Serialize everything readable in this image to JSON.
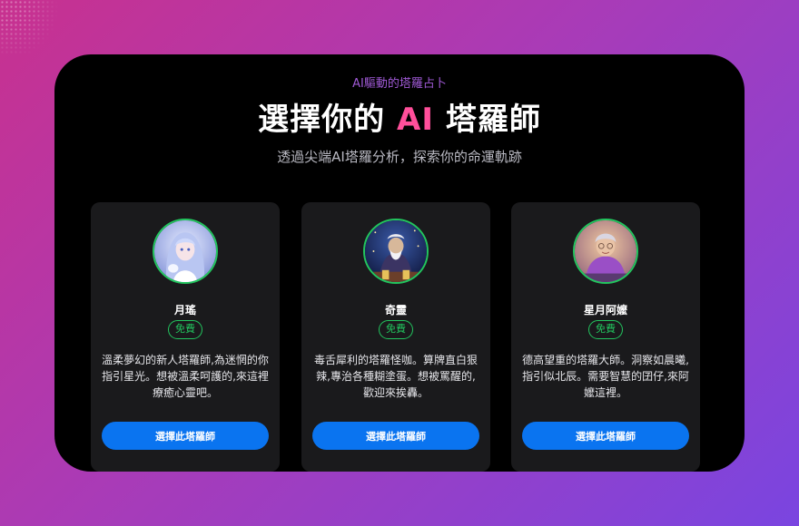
{
  "hero": {
    "eyebrow": "AI驅動的塔羅占卜",
    "title_prefix": "選擇你的 ",
    "title_highlight": "AI",
    "title_suffix": " 塔羅師",
    "subtitle": "透過尖端AI塔羅分析，探索你的命運軌跡"
  },
  "colors": {
    "accent_pink": "#ff4f9a",
    "eyebrow_purple": "#a05ad6",
    "badge_green": "#22c55e",
    "button_blue": "#0a74f0"
  },
  "readers": [
    {
      "name": "月瑤",
      "badge": "免費",
      "description": "溫柔夢幻的新人塔羅師,為迷惘的你指引星光。想被溫柔呵護的,來這裡療癒心靈吧。",
      "button": "選擇此塔羅師",
      "avatar_icon": "anime-girl-avatar-icon"
    },
    {
      "name": "奇靈",
      "badge": "免費",
      "description": "毒舌犀利的塔羅怪咖。算牌直白狠辣,專治各種糊塗蛋。想被罵醒的,歡迎來挨轟。",
      "button": "選擇此塔羅師",
      "avatar_icon": "old-wizard-avatar-icon"
    },
    {
      "name": "星月阿嬤",
      "badge": "免費",
      "description": "德高望重的塔羅大師。洞察如晨曦,指引似北辰。需要智慧的囝仔,來阿嬤這裡。",
      "button": "選擇此塔羅師",
      "avatar_icon": "grandma-avatar-icon"
    }
  ]
}
